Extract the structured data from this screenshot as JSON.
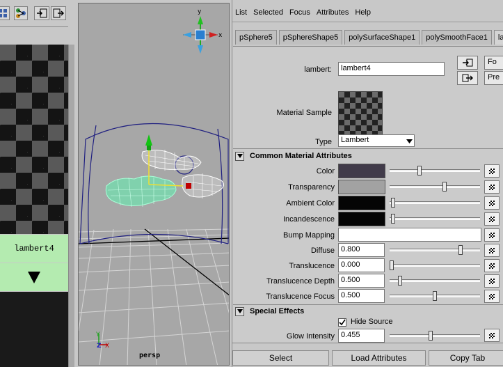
{
  "node_label": "lambert4",
  "viewport": {
    "camera": "persp",
    "axis_labels": {
      "x": "x",
      "y": "y",
      "z": "z"
    }
  },
  "menu": [
    "List",
    "Selected",
    "Focus",
    "Attributes",
    "Help"
  ],
  "tabs": [
    "pSphere5",
    "pSphereShape5",
    "polySurfaceShape1",
    "polySmoothFace1",
    "lamber"
  ],
  "header": {
    "name_label": "lambert:",
    "name_value": "lambert4",
    "focus_btn": "Fo",
    "presets_btn": "Pre",
    "material_sample_label": "Material Sample",
    "type_label": "Type",
    "type_value": "Lambert"
  },
  "sections": {
    "common": "Common Material Attributes",
    "special": "Special Effects"
  },
  "attributes": [
    {
      "label": "Color",
      "kind": "color",
      "color": "#413b4a",
      "level": 0.32
    },
    {
      "label": "Transparency",
      "kind": "color",
      "color": "#a2a2a2",
      "level": 0.61
    },
    {
      "label": "Ambient Color",
      "kind": "color",
      "color": "#050505",
      "level": 0.02
    },
    {
      "label": "Incandescence",
      "kind": "color",
      "color": "#050505",
      "level": 0.02
    },
    {
      "label": "Bump Mapping",
      "kind": "map"
    },
    {
      "label": "Diffuse",
      "kind": "number",
      "value": "0.800",
      "level": 0.8
    },
    {
      "label": "Translucence",
      "kind": "number",
      "value": "0.000",
      "level": 0.0
    },
    {
      "label": "Translucence Depth",
      "kind": "number",
      "value": "0.500",
      "level": 0.1
    },
    {
      "label": "Translucence Focus",
      "kind": "number",
      "value": "0.500",
      "level": 0.5
    }
  ],
  "special": {
    "hide_source_label": "Hide Source",
    "hide_source_checked": true,
    "glow_label": "Glow Intensity",
    "glow_value": "0.455",
    "glow_level": 0.455
  },
  "buttons": {
    "select": "Select",
    "load": "Load Attributes",
    "copy": "Copy Tab"
  }
}
